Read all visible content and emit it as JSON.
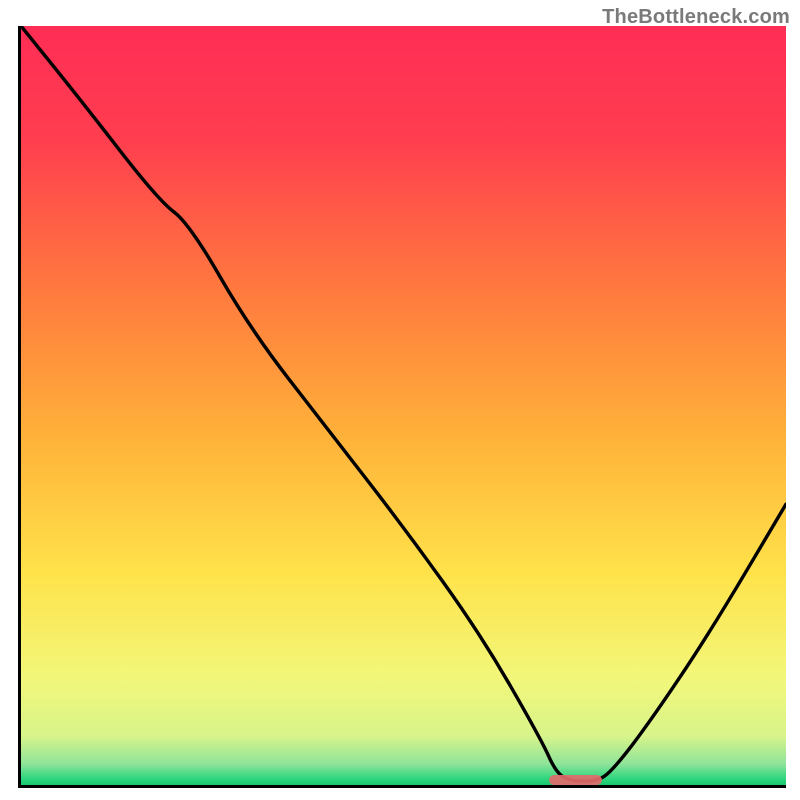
{
  "watermark": "TheBottleneck.com",
  "chart_data": {
    "type": "line",
    "title": "",
    "xlabel": "",
    "ylabel": "",
    "xlim": [
      0,
      100
    ],
    "ylim": [
      0,
      100
    ],
    "grid": false,
    "description": "Single black curve over a vertical red→orange→yellow→green gradient; minimum near x≈72.",
    "series": [
      {
        "name": "curve",
        "x": [
          0,
          8,
          18,
          22,
          30,
          40,
          50,
          60,
          68,
          70,
          72,
          75,
          77,
          82,
          90,
          100
        ],
        "values": [
          100,
          90,
          77,
          74,
          60,
          47,
          34,
          20,
          6,
          1.5,
          0.5,
          0.5,
          1.5,
          8,
          20,
          37
        ]
      }
    ],
    "min_marker": {
      "x_start": 69,
      "x_end": 76,
      "y": 0.7
    },
    "gradient_stops": [
      {
        "offset": 0.0,
        "color": "#ff2d55"
      },
      {
        "offset": 0.15,
        "color": "#ff3e4f"
      },
      {
        "offset": 0.35,
        "color": "#ff7a3e"
      },
      {
        "offset": 0.55,
        "color": "#ffb43a"
      },
      {
        "offset": 0.72,
        "color": "#ffe24a"
      },
      {
        "offset": 0.86,
        "color": "#f2f77a"
      },
      {
        "offset": 0.935,
        "color": "#d8f48a"
      },
      {
        "offset": 0.972,
        "color": "#8fe49a"
      },
      {
        "offset": 0.992,
        "color": "#2dd67e"
      },
      {
        "offset": 1.0,
        "color": "#17c96f"
      }
    ]
  }
}
